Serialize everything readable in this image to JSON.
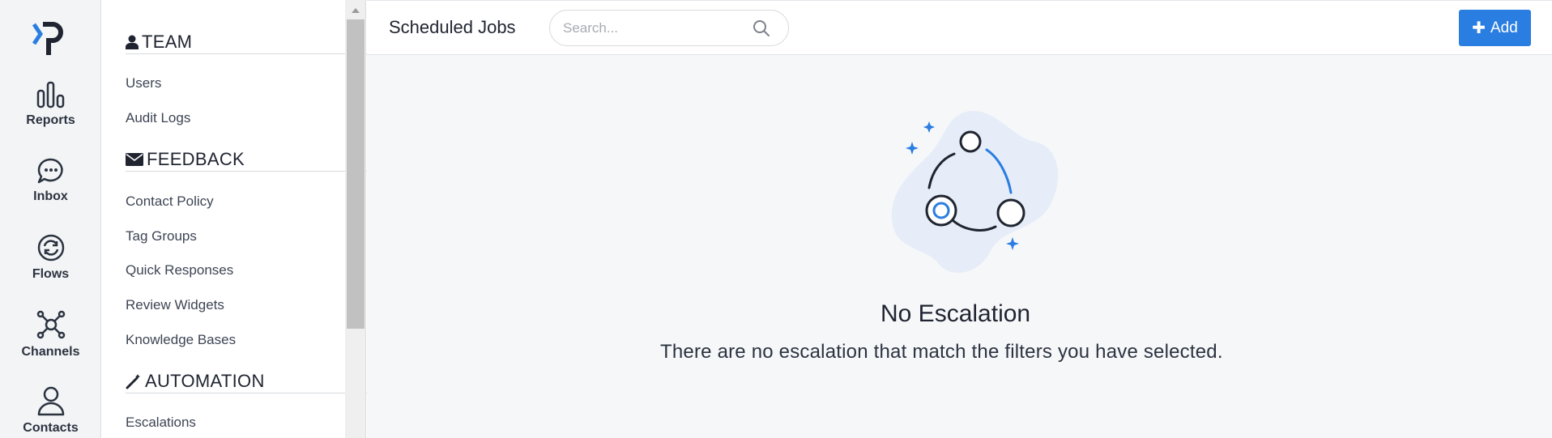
{
  "rail": {
    "items": [
      {
        "label": "Reports",
        "icon": "bar-chart-icon"
      },
      {
        "label": "Inbox",
        "icon": "chat-bubble-icon"
      },
      {
        "label": "Flows",
        "icon": "sync-icon"
      },
      {
        "label": "Channels",
        "icon": "network-icon"
      },
      {
        "label": "Contacts",
        "icon": "person-icon"
      }
    ]
  },
  "menu": {
    "sections": [
      {
        "title": "TEAM",
        "icon": "user-icon",
        "links": [
          "Users",
          "Audit Logs"
        ]
      },
      {
        "title": "FEEDBACK",
        "icon": "envelope-icon",
        "links": [
          "Contact Policy",
          "Tag Groups",
          "Quick Responses",
          "Review Widgets",
          "Knowledge Bases"
        ]
      },
      {
        "title": "AUTOMATION",
        "icon": "magic-wand-icon",
        "links": [
          "Escalations"
        ]
      }
    ]
  },
  "header": {
    "title": "Scheduled Jobs",
    "search_placeholder": "Search...",
    "add_label": "Add"
  },
  "empty_state": {
    "title": "No Escalation",
    "description": "There are no escalation that match the filters you have selected."
  },
  "colors": {
    "accent": "#2a7de1",
    "rail_bg": "#f3f4f6",
    "main_bg": "#f6f7f9",
    "illustration_blob": "#e6edf8"
  }
}
